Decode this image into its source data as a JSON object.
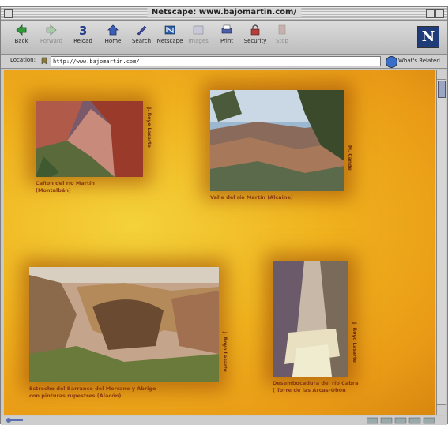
{
  "window": {
    "title": "Netscape: www.bajomartin.com/"
  },
  "toolbar": {
    "buttons": [
      {
        "label": "Back",
        "icon": "back-arrow-icon",
        "enabled": true
      },
      {
        "label": "Forward",
        "icon": "forward-arrow-icon",
        "enabled": false
      },
      {
        "label": "Reload",
        "icon": "reload-icon",
        "enabled": true
      },
      {
        "label": "Home",
        "icon": "home-icon",
        "enabled": true
      },
      {
        "label": "Search",
        "icon": "search-icon",
        "enabled": true
      },
      {
        "label": "Netscape",
        "icon": "netscape-icon",
        "enabled": true
      },
      {
        "label": "Images",
        "icon": "images-icon",
        "enabled": false
      },
      {
        "label": "Print",
        "icon": "print-icon",
        "enabled": true
      },
      {
        "label": "Security",
        "icon": "security-lock-icon",
        "enabled": true
      },
      {
        "label": "Stop",
        "icon": "stop-icon",
        "enabled": false
      }
    ],
    "logo": "N"
  },
  "location": {
    "label": "Location:",
    "url": "http://www.bajomartin.com/",
    "related_label": "What's Related"
  },
  "gallery": [
    {
      "credit": "J. Royo Lasarte",
      "caption_lines": [
        "Cañon del río Martín",
        "(Montalbán)"
      ]
    },
    {
      "credit": "M. Candel",
      "caption_lines": [
        "Valle del río Martín (Alcaine)"
      ]
    },
    {
      "credit": "J. Royo Lasarte",
      "caption_lines": [
        "Estrecho del Barranco del Morrano y Abrigo",
        "con pinturas rupestres (Alacón)."
      ]
    },
    {
      "credit": "J. Royo Lasarte",
      "caption_lines": [
        "Desembocadura del río Cabra",
        "( Torre de las Arcas-Obón"
      ]
    }
  ],
  "colors": {
    "page_background": "#f0b21e",
    "photo_shadow": "#96460a",
    "caption": "#8a3a10"
  }
}
